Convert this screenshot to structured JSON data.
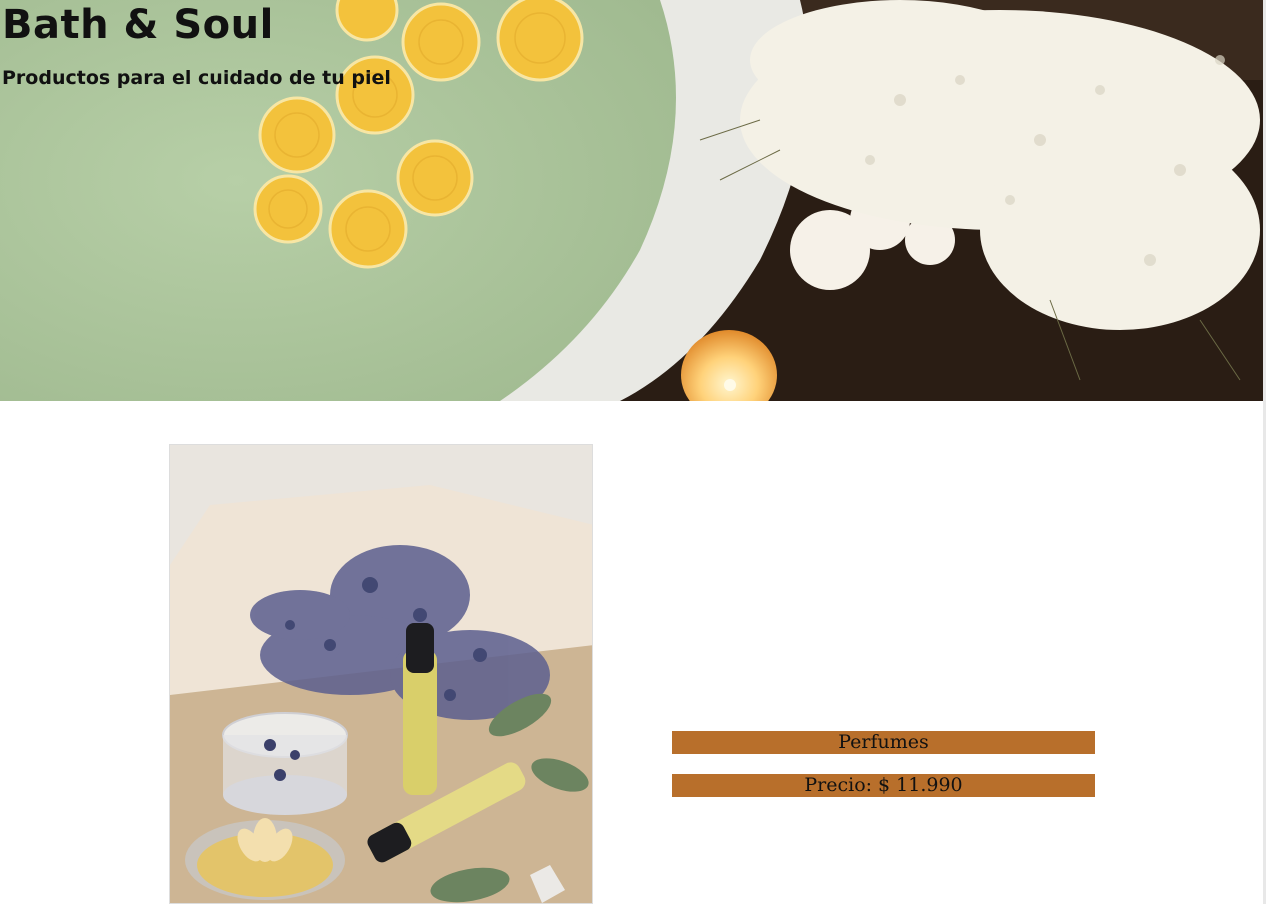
{
  "header": {
    "title": "Bath & Soul",
    "subtitle": "Productos para el cuidado de tu piel",
    "background_image": "spa-bath-flowers-icon"
  },
  "product": {
    "image": "lavender-perfume-oils-icon",
    "name": "Perfumes",
    "price_label": "Precio:",
    "price_value": "$ 11.990"
  },
  "colors": {
    "accent": "#b86f2b",
    "text": "#111111",
    "background": "#ffffff"
  }
}
